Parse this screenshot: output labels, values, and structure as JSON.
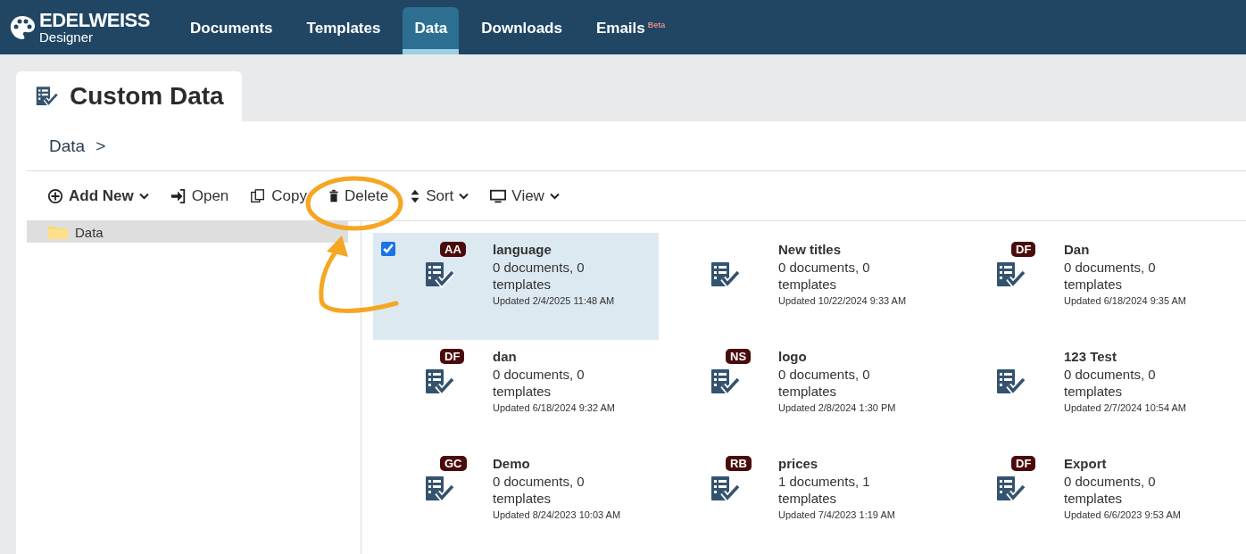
{
  "app": {
    "logo_title": "EDELWEISS",
    "logo_subtitle": "Designer"
  },
  "nav": [
    {
      "label": "Documents",
      "selected": false
    },
    {
      "label": "Templates",
      "selected": false
    },
    {
      "label": "Data",
      "selected": true
    },
    {
      "label": "Downloads",
      "selected": false
    },
    {
      "label": "Emails",
      "selected": false,
      "badge": "Beta"
    }
  ],
  "page_title": "Custom Data",
  "breadcrumb": [
    "Data",
    ">"
  ],
  "toolbar": [
    {
      "kind": "add",
      "label": "Add New",
      "caret": true
    },
    {
      "kind": "open",
      "label": "Open",
      "caret": false
    },
    {
      "kind": "copy",
      "label": "Copy",
      "caret": false
    },
    {
      "kind": "delete",
      "label": "Delete",
      "caret": false,
      "highlighted": true
    },
    {
      "kind": "sort",
      "label": "Sort",
      "caret": true
    },
    {
      "kind": "view",
      "label": "View",
      "caret": true
    }
  ],
  "tree": [
    {
      "label": "Data",
      "selected": true
    }
  ],
  "items": [
    {
      "name": "language",
      "badge": "AA",
      "counts": "0 documents, 0 templates",
      "updated": "Updated 2/4/2025 11:48 AM",
      "selected": true
    },
    {
      "name": "New titles",
      "counts": "0 documents, 0 templates",
      "updated": "Updated 10/22/2024 9:33 AM",
      "selected": false
    },
    {
      "name": "Dan",
      "badge": "DF",
      "counts": "0 documents, 0 templates",
      "updated": "Updated 6/18/2024 9:35 AM",
      "selected": false
    },
    {
      "name": "dan",
      "badge": "DF",
      "counts": "0 documents, 0 templates",
      "updated": "Updated 6/18/2024 9:32 AM",
      "selected": false
    },
    {
      "name": "logo",
      "badge": "NS",
      "counts": "0 documents, 0 templates",
      "updated": "Updated 2/8/2024 1:30 PM",
      "selected": false
    },
    {
      "name": "123 Test",
      "counts": "0 documents, 0 templates",
      "updated": "Updated 2/7/2024 10:54 AM",
      "selected": false
    },
    {
      "name": "Demo",
      "badge": "GC",
      "counts": "0 documents, 0 templates",
      "updated": "Updated 8/24/2023 10:03 AM",
      "selected": false
    },
    {
      "name": "prices",
      "badge": "RB",
      "counts": "1 documents, 1 templates",
      "updated": "Updated 7/4/2023 1:19 AM",
      "selected": false
    },
    {
      "name": "Export",
      "badge": "DF",
      "counts": "0 documents, 0 templates",
      "updated": "Updated 6/6/2023 9:53 AM",
      "selected": false
    }
  ]
}
